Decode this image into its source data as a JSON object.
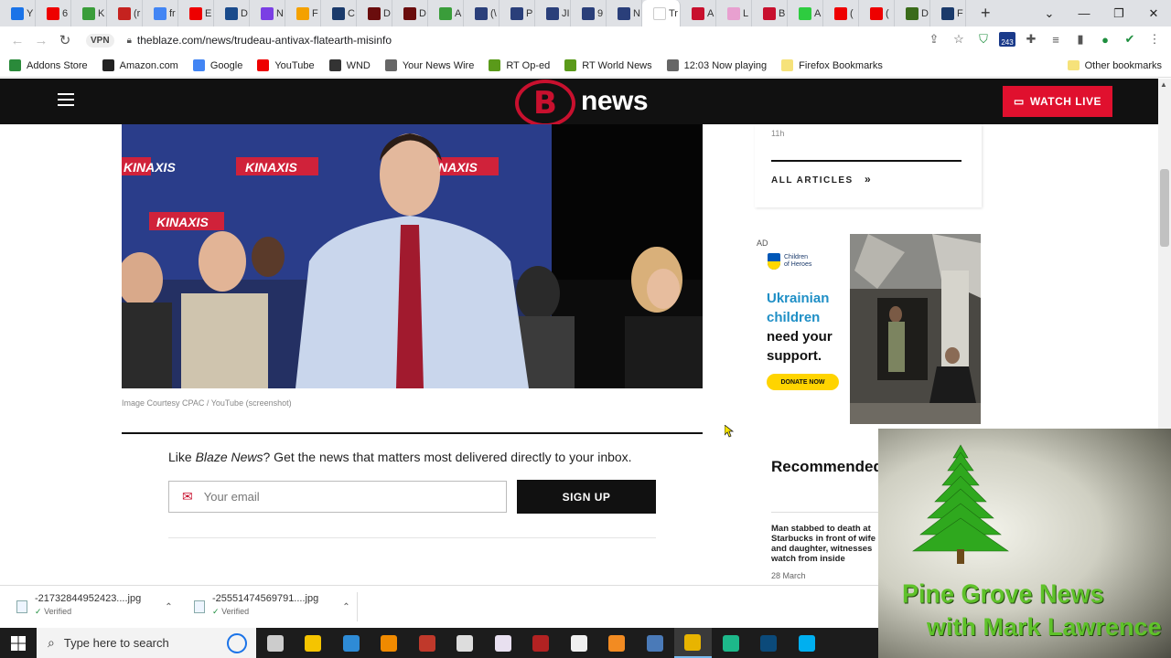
{
  "browser": {
    "tabs": [
      {
        "label": "Y",
        "color": "#1a73e8"
      },
      {
        "label": "6",
        "color": "#e00"
      },
      {
        "label": "K",
        "color": "#3a9d3a"
      },
      {
        "label": "(r",
        "color": "#c5221f"
      },
      {
        "label": "fr",
        "color": "#4285f4"
      },
      {
        "label": "E",
        "color": "#e00"
      },
      {
        "label": "D",
        "color": "#1a4b8c"
      },
      {
        "label": "N",
        "color": "#7b3fe4"
      },
      {
        "label": "F",
        "color": "#f4a100"
      },
      {
        "label": "C",
        "color": "#1a3a6b"
      },
      {
        "label": "D",
        "color": "#6a0d0d"
      },
      {
        "label": "D",
        "color": "#6a0d0d"
      },
      {
        "label": "A",
        "color": "#3a9d3a"
      },
      {
        "label": "(\\",
        "color": "#2a3f7a"
      },
      {
        "label": "P",
        "color": "#2a3f7a"
      },
      {
        "label": "JI",
        "color": "#2a3f7a"
      },
      {
        "label": "9",
        "color": "#2a3f7a"
      },
      {
        "label": "N",
        "color": "#2a3f7a"
      },
      {
        "label": "Tr",
        "color": "#ffffff"
      },
      {
        "label": "A",
        "color": "#c8102e"
      },
      {
        "label": "L",
        "color": "#e8a0d0"
      },
      {
        "label": "B",
        "color": "#c8102e"
      },
      {
        "label": "A",
        "color": "#2ecc40"
      },
      {
        "label": "(",
        "color": "#e00"
      },
      {
        "label": "(",
        "color": "#e00"
      },
      {
        "label": "D",
        "color": "#3a6b1a"
      },
      {
        "label": "F",
        "color": "#1a3a6b"
      }
    ],
    "active_tab_index": 18,
    "new_tab_label": "+",
    "url": "theblaze.com/news/trudeau-antivax-flatearth-misinfo",
    "vpn_label": "VPN",
    "extension_badge": "243",
    "bookmarks": [
      {
        "label": "Addons Store",
        "color": "#2a8a3a"
      },
      {
        "label": "Amazon.com",
        "color": "#222"
      },
      {
        "label": "Google",
        "color": "#4285f4"
      },
      {
        "label": "YouTube",
        "color": "#e00"
      },
      {
        "label": "WND",
        "color": "#333"
      },
      {
        "label": "Your News Wire",
        "color": "#666"
      },
      {
        "label": "RT Op-ed",
        "color": "#5a9a1a"
      },
      {
        "label": "RT World News",
        "color": "#5a9a1a"
      },
      {
        "label": "12:03  Now playing",
        "color": "#666"
      },
      {
        "label": "Firefox Bookmarks",
        "color": "#f6e27a"
      }
    ],
    "other_bookmarks": "Other bookmarks"
  },
  "site": {
    "logo_mark": "B",
    "logo_text": "news",
    "watch_live": "WATCH LIVE"
  },
  "article": {
    "image_credit": "Image Courtesy CPAC / YouTube (screenshot)",
    "backdrop_text": [
      "KINAXIS",
      "KINAXIS",
      "KINAXIS",
      "KINAXIS"
    ],
    "newsletter_prefix": "Like ",
    "newsletter_brand": "Blaze News",
    "newsletter_suffix": "? Get the news that matters most delivered directly to your inbox.",
    "email_placeholder": "Your email",
    "signup_label": "SIGN UP"
  },
  "sidebar": {
    "time_ago": "11h",
    "all_articles": "ALL ARTICLES",
    "ad_label": "AD",
    "ad_org_line1": "Children",
    "ad_org_line2": "of Heroes",
    "ad_headline_1": "Ukrainian",
    "ad_headline_2": "children",
    "ad_body_1": "need your",
    "ad_body_2": "support.",
    "ad_button": "DONATE NOW",
    "recommended_title": "Recommended",
    "recommended_item_title": "Man stabbed to death at Starbucks in front of wife and daughter, witnesses watch from inside",
    "recommended_item_date": "28 March"
  },
  "downloads": [
    {
      "name": "-21732844952423....jpg",
      "status": "Verified"
    },
    {
      "name": "-25551474569791....jpg",
      "status": "Verified"
    }
  ],
  "overlay": {
    "title": "Pine Grove News",
    "subtitle": "with Mark Lawrence"
  },
  "taskbar": {
    "search_placeholder": "Type here to search",
    "apps": [
      {
        "name": "task-view",
        "color": "#cccccc"
      },
      {
        "name": "file-explorer",
        "color": "#f5c400"
      },
      {
        "name": "paint",
        "color": "#2e8bd6"
      },
      {
        "name": "vlc",
        "color": "#f08a00"
      },
      {
        "name": "paint-net",
        "color": "#c0392b"
      },
      {
        "name": "settings",
        "color": "#dddddd"
      },
      {
        "name": "app-grid",
        "color": "#e8e0f0"
      },
      {
        "name": "bug-tool",
        "color": "#b22222"
      },
      {
        "name": "notepad",
        "color": "#f0f0f0"
      },
      {
        "name": "orange-app",
        "color": "#f28b22"
      },
      {
        "name": "k-app",
        "color": "#4a7ab8"
      },
      {
        "name": "chrome",
        "color": "#e8b400"
      },
      {
        "name": "green-app",
        "color": "#1db88a"
      },
      {
        "name": "video-app",
        "color": "#0b4a7a"
      },
      {
        "name": "skype",
        "color": "#00aff0"
      }
    ],
    "active_app_index": 11
  }
}
